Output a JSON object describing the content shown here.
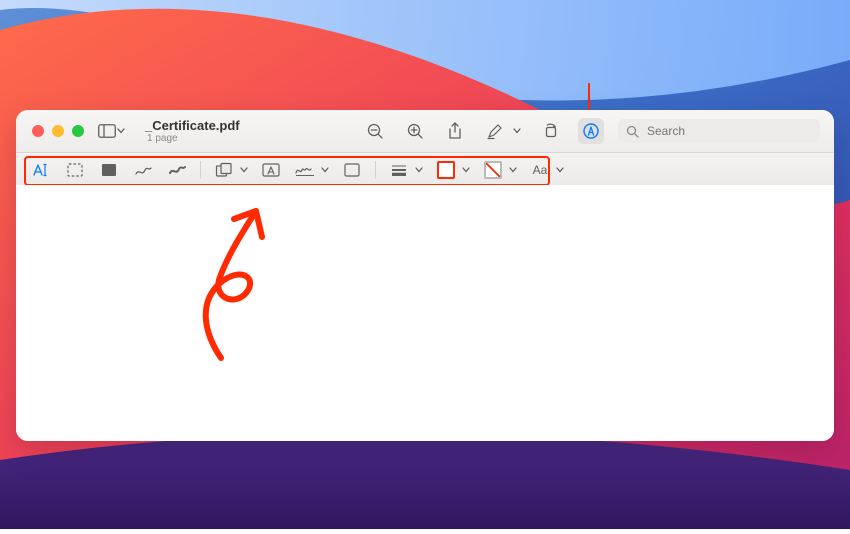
{
  "colors": {
    "annotation": "#ff2a00",
    "markup_active": "#0a7aff"
  },
  "window": {
    "title": "_Certificate.pdf",
    "page_count_label": "1 page"
  },
  "toolbar": {
    "zoom_out": "Zoom Out",
    "zoom_in": "Zoom In",
    "share": "Share",
    "highlight": "Highlight",
    "rotate": "Rotate",
    "markup": "Markup"
  },
  "search": {
    "placeholder": "Search",
    "value": ""
  },
  "markup": {
    "text_selection": "A|",
    "text_style_label": "Aa"
  }
}
